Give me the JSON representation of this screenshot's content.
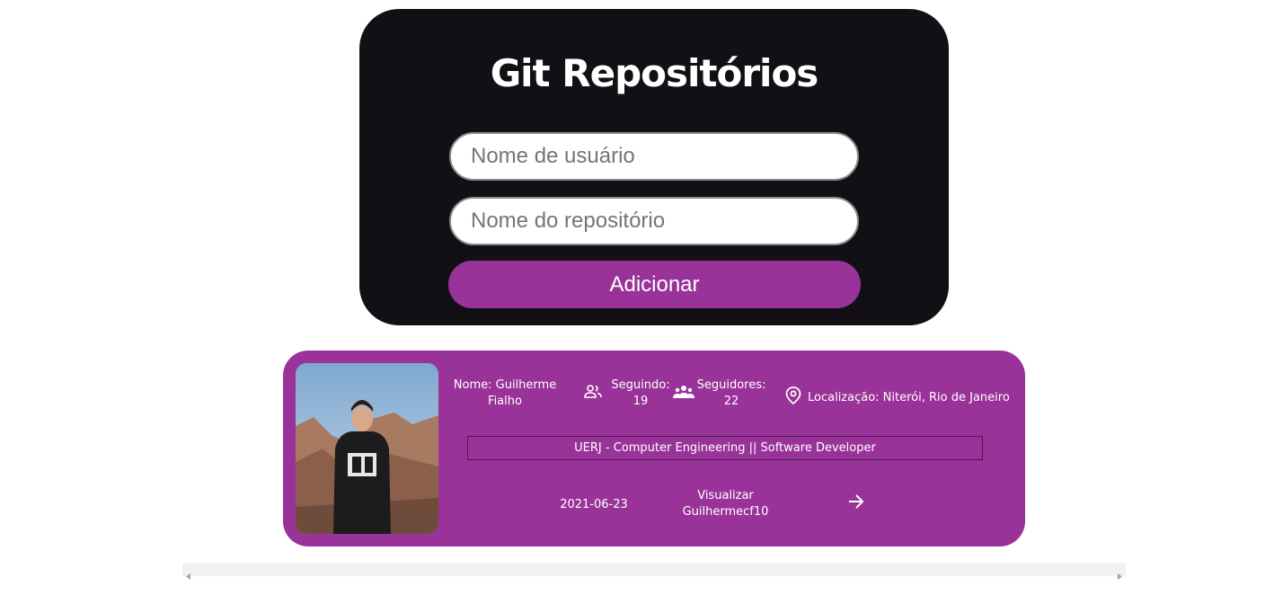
{
  "header": {
    "title": "Git Repositórios"
  },
  "form": {
    "user_placeholder": "Nome de usuário",
    "repo_placeholder": "Nome do repositório",
    "add_label": "Adicionar"
  },
  "profile": {
    "name": "Nome: Guilherme Fialho",
    "following_label": "Seguindo:",
    "following_count": "19",
    "followers_label": "Seguidores:",
    "followers_count": "22",
    "location": "Localização: Niterói, Rio de Janeiro",
    "bio": "UERJ - Computer Engineering || Software Developer",
    "date": "2021-06-23",
    "view_label": "Visualizar",
    "view_repo": "Guilhermecf10"
  },
  "colors": {
    "header_bg": "#121015",
    "accent": "#9a3399",
    "page_bg": "#ffffff"
  },
  "icons": {
    "following": "people-outline-icon",
    "followers": "groups-icon",
    "location": "location-pin-icon",
    "view": "arrow-right-icon"
  }
}
